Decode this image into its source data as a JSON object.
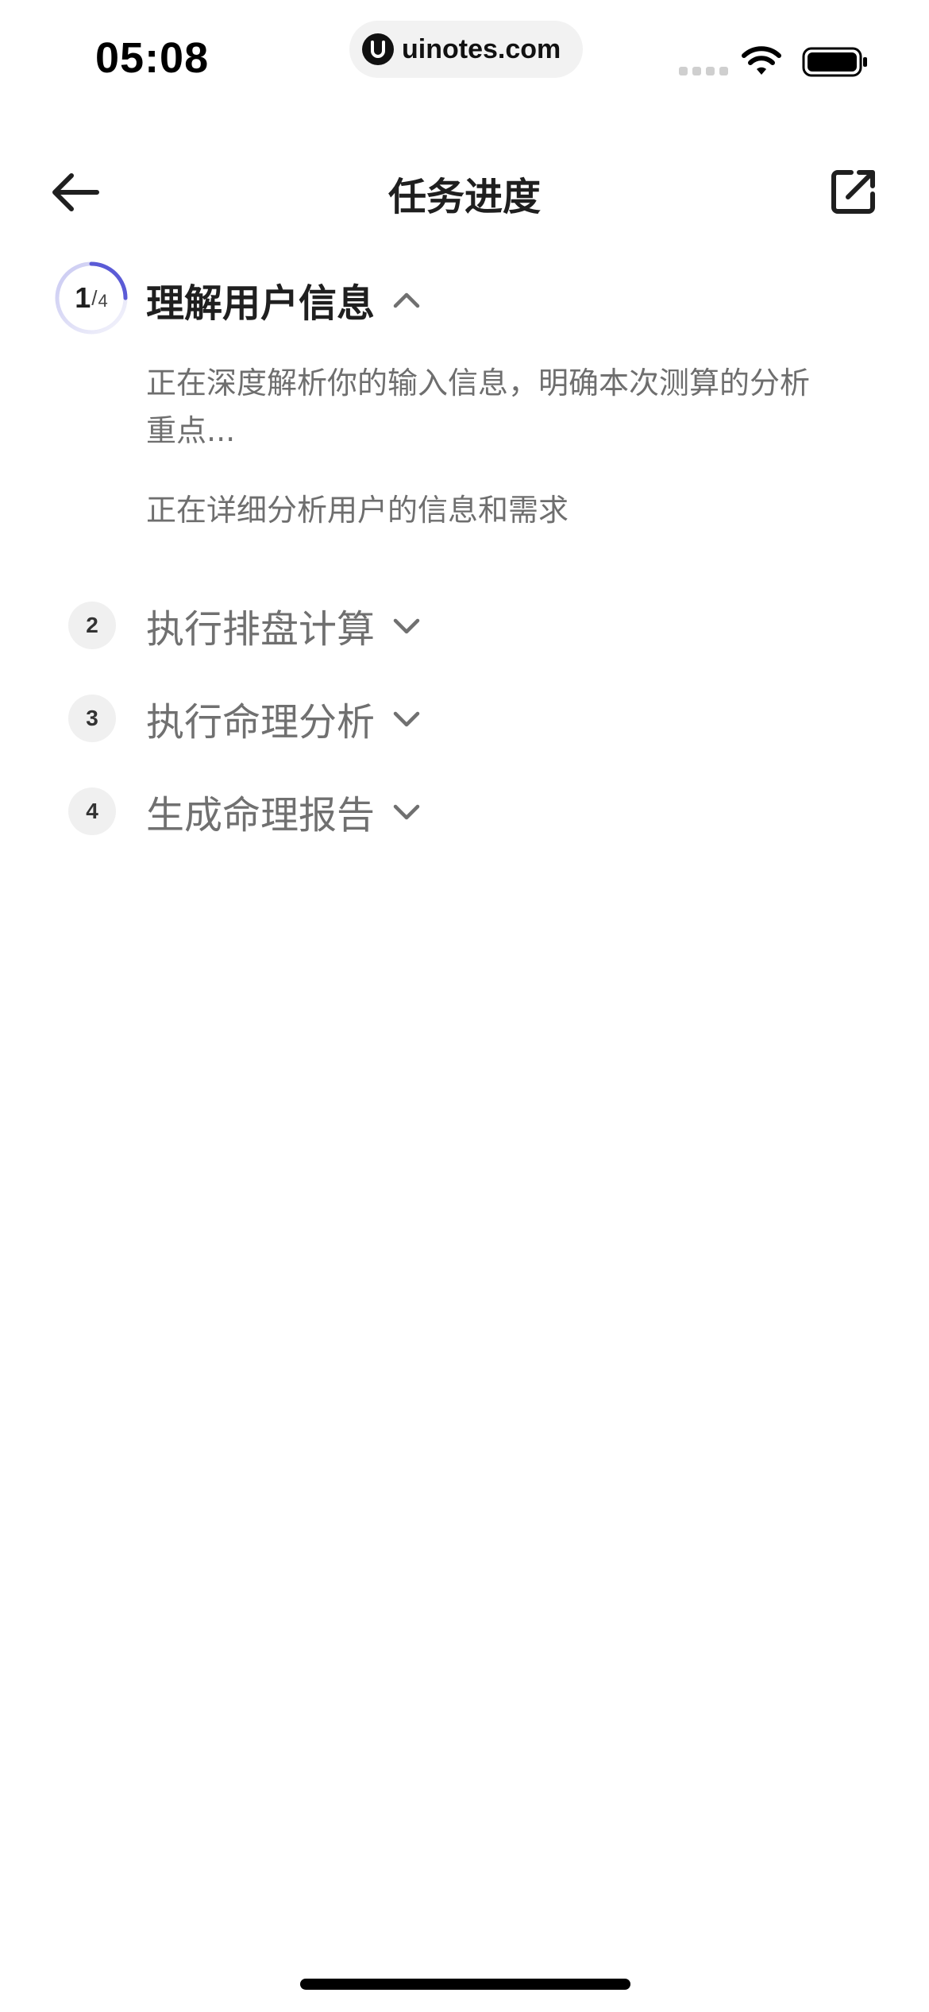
{
  "status_bar": {
    "time": "05:08",
    "url": "uinotes.com",
    "icons": [
      "signal-icon",
      "wifi-icon",
      "battery-icon"
    ]
  },
  "nav": {
    "title": "任务进度",
    "back_icon": "arrow-left-icon",
    "share_icon": "share-external-icon"
  },
  "progress": {
    "current": "1",
    "separator": "/",
    "total": "4",
    "fraction": 0.25,
    "ring_color": "#5b5bd6"
  },
  "steps": [
    {
      "number": "1",
      "title": "理解用户信息",
      "expanded": true,
      "details": [
        "正在深度解析你的输入信息，明确本次测算的分析重点...",
        "正在详细分析用户的信息和需求"
      ]
    },
    {
      "number": "2",
      "title": "执行排盘计算",
      "expanded": false
    },
    {
      "number": "3",
      "title": "执行命理分析",
      "expanded": false
    },
    {
      "number": "4",
      "title": "生成命理报告",
      "expanded": false
    }
  ]
}
